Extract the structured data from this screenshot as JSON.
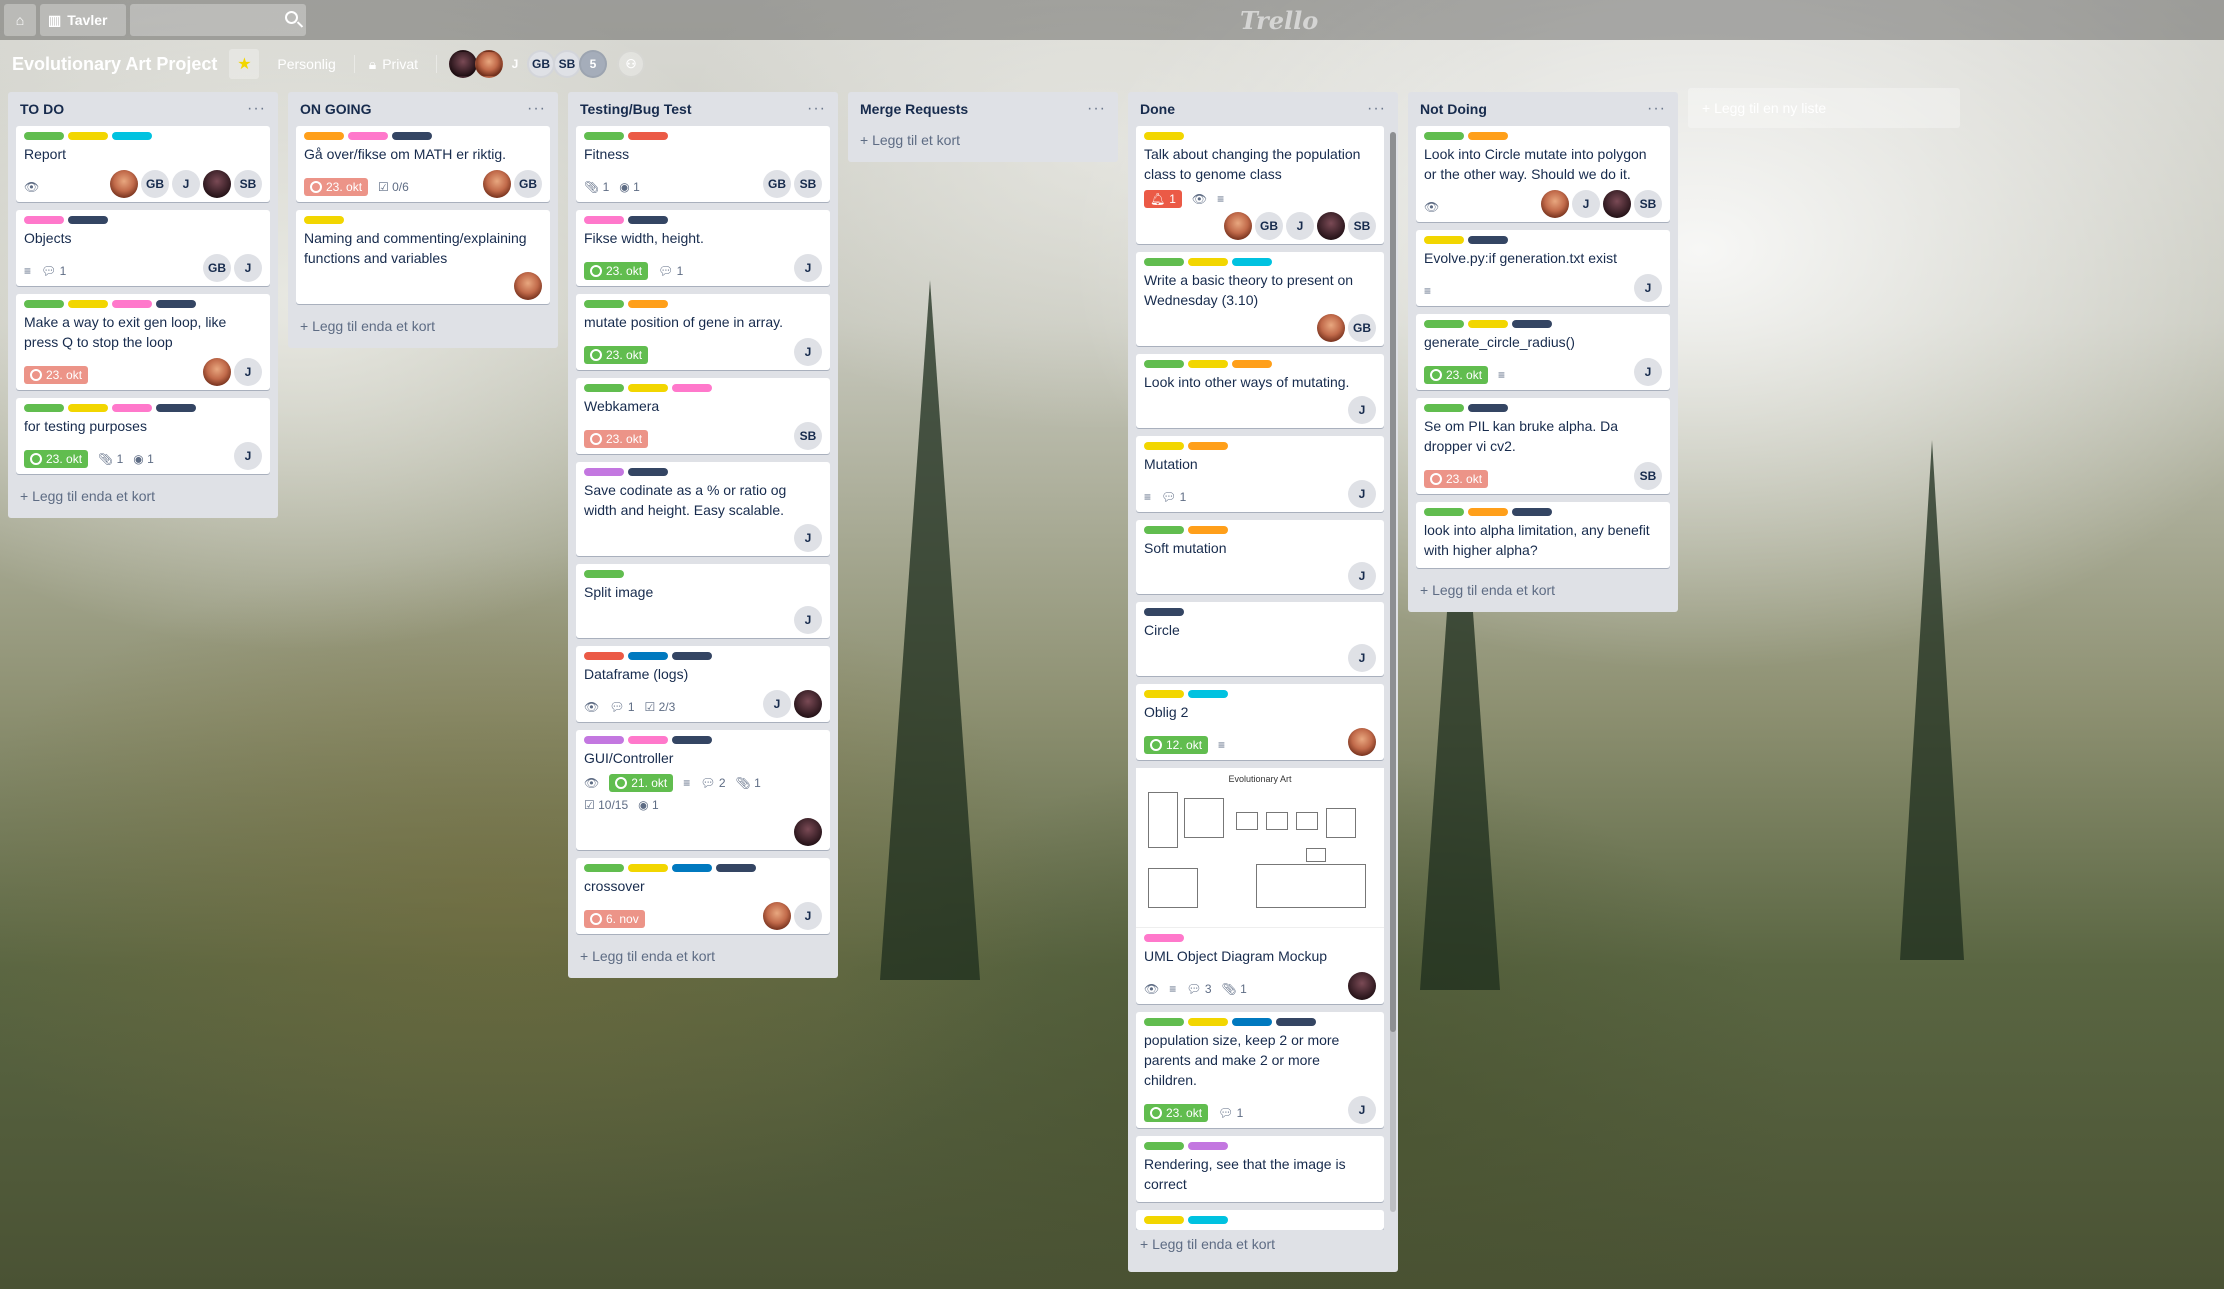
{
  "topbar": {
    "boards_label": "Tavler",
    "logo": "Trello"
  },
  "board": {
    "title": "Evolutionary Art Project",
    "visibility_team": "Personlig",
    "visibility": "Privat",
    "members": [
      "",
      "",
      "J",
      "GB",
      "SB",
      "5"
    ]
  },
  "add_list": "+ Legg til en ny liste",
  "lists": [
    {
      "title": "TO DO",
      "add": "+ Legg til enda et kort",
      "cards": [
        {
          "title": "Report"
        },
        {
          "title": "Objects",
          "comments": "1"
        },
        {
          "title": "Make a way to exit gen loop, like press Q to stop the loop",
          "due": "23. okt"
        },
        {
          "title": "for testing purposes",
          "due": "23. okt",
          "attachments": "1",
          "commits": "1"
        }
      ]
    },
    {
      "title": "ON GOING",
      "add": "+ Legg til enda et kort",
      "cards": [
        {
          "title": "Gå over/fikse om MATH er riktig.",
          "due": "23. okt",
          "checklist": "0/6"
        },
        {
          "title": "Naming and commenting/explaining functions and variables"
        }
      ]
    },
    {
      "title": "Testing/Bug Test",
      "add": "+ Legg til enda et kort",
      "cards": [
        {
          "title": "Fitness",
          "attachments": "1",
          "commits": "1"
        },
        {
          "title": "Fikse width, height.",
          "due": "23. okt",
          "comments": "1"
        },
        {
          "title": "mutate position of gene in array.",
          "due": "23. okt"
        },
        {
          "title": "Webkamera",
          "due": "23. okt"
        },
        {
          "title": "Save codinate as a % or ratio og width and height. Easy scalable."
        },
        {
          "title": "Split image"
        },
        {
          "title": "Dataframe (logs)",
          "comments": "1",
          "checklist": "2/3"
        },
        {
          "title": "GUI/Controller",
          "due": "21. okt",
          "comments": "2",
          "attachments": "1",
          "checklist": "10/15",
          "commits": "1"
        },
        {
          "title": "crossover",
          "due": "6. nov"
        }
      ]
    },
    {
      "title": "Merge Requests",
      "add": "+ Legg til et kort",
      "cards": []
    },
    {
      "title": "Done",
      "add": "+ Legg til enda et kort",
      "cards": [
        {
          "title": "Talk about changing the population class to genome class",
          "notifications": "1"
        },
        {
          "title": "Write a basic theory to present on Wednesday (3.10)"
        },
        {
          "title": "Look into other ways of mutating."
        },
        {
          "title": "Mutation",
          "comments": "1"
        },
        {
          "title": "Soft mutation"
        },
        {
          "title": "Circle"
        },
        {
          "title": "Oblig 2",
          "due": "12. okt"
        },
        {
          "title": "UML Object Diagram Mockup",
          "cover_title": "Evolutionary Art",
          "comments": "3",
          "attachments": "1"
        },
        {
          "title": "population size, keep 2 or more parents and make 2 or more children.",
          "due": "23. okt",
          "comments": "1"
        },
        {
          "title": "Rendering, see that the image is correct"
        }
      ]
    },
    {
      "title": "Not Doing",
      "add": "+ Legg til enda et kort",
      "cards": [
        {
          "title": "Look into Circle mutate into polygon or the other way. Should we do it."
        },
        {
          "title": "Evolve.py:if generation.txt exist"
        },
        {
          "title": "generate_circle_radius()",
          "due": "23. okt"
        },
        {
          "title": "Se om PIL kan bruke alpha. Da dropper vi cv2.",
          "due": "23. okt"
        },
        {
          "title": "look into alpha limitation, any benefit with higher alpha?"
        }
      ]
    }
  ],
  "avatars": {
    "gb": "GB",
    "j": "J",
    "sb": "SB"
  }
}
